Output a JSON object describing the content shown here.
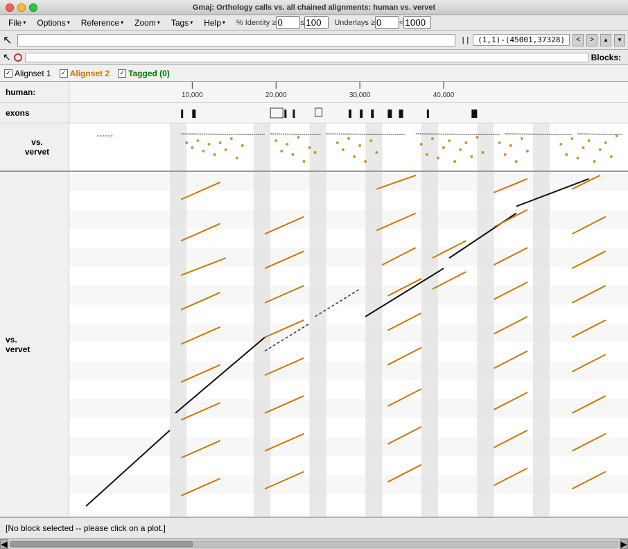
{
  "window": {
    "title": "Gmaj: Orthology calls vs. all chained alignments: human vs. vervet"
  },
  "titlebar": {
    "buttons": [
      "close",
      "minimize",
      "maximize"
    ]
  },
  "menubar": {
    "items": [
      {
        "label": "File",
        "id": "file"
      },
      {
        "label": "Options",
        "id": "options"
      },
      {
        "label": "Reference",
        "id": "reference"
      },
      {
        "label": "Zoom",
        "id": "zoom"
      },
      {
        "label": "Tags",
        "id": "tags"
      },
      {
        "label": "Help",
        "id": "help"
      }
    ]
  },
  "toolbar": {
    "identity_label": "% Identity ≥",
    "identity_min": "0",
    "identity_sep": "≤",
    "identity_max": "100",
    "underlays_label": "Underlays ≥",
    "underlays_min": "0",
    "underlays_sep": "<",
    "underlays_max": "1000",
    "coords": "(1,1)-(45001,37328)",
    "pipe_sep": "||"
  },
  "legend": {
    "items": [
      {
        "label": "Alignset 1",
        "color": "black",
        "checked": true
      },
      {
        "label": "Alignset 2",
        "color": "orange",
        "checked": true
      },
      {
        "label": "Tagged (0)",
        "color": "green",
        "checked": true
      }
    ]
  },
  "ruler": {
    "label": "human:",
    "ticks": [
      {
        "pos": 22,
        "label": "10,000"
      },
      {
        "pos": 37,
        "label": "20,000"
      },
      {
        "pos": 52,
        "label": "30,000"
      },
      {
        "pos": 67,
        "label": "40,000"
      }
    ]
  },
  "exons": {
    "label": "exons"
  },
  "mini_plot": {
    "label_line1": "vs.",
    "label_line2": "vervet"
  },
  "main_plot": {
    "label_line1": "vs.",
    "label_line2": "vervet"
  },
  "status": {
    "message": "[No block selected -- please click on a plot.]"
  },
  "blocks_label": "Blocks:"
}
